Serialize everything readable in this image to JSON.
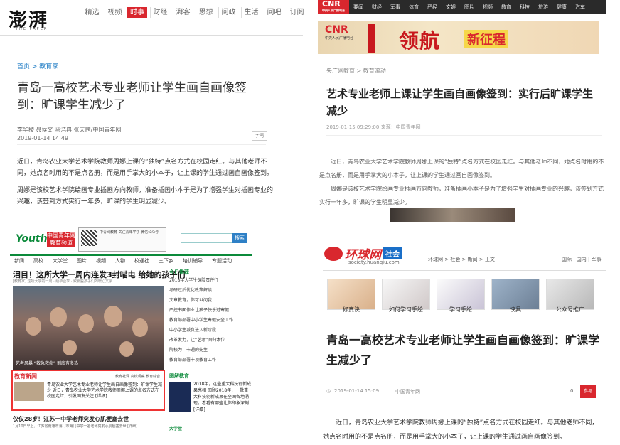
{
  "thepaper": {
    "logo": "澎湃",
    "logo_sub": "THE PAPER",
    "nav": [
      "精选",
      "视频",
      "时事",
      "财经",
      "湃客",
      "思想",
      "问政",
      "生活",
      "问吧",
      "订阅"
    ],
    "active_nav": "时事",
    "breadcrumb": "首页 > 教育家",
    "title": "青岛一高校艺术专业老师让学生画自画像签到：旷课学生减少了",
    "authors": "李华稷 聂侯文 马浩冉 张天茜/中国青年网",
    "date": "2019-01-14 14:49",
    "font_size_label": "字号",
    "para1": "近日，青岛农业大学艺术学院教师周娜上课的“独特”点名方式在校园走红。与其他老师不同，她点名时用的不是点名册，而是用手掌大的小本子，让上课的学生通过画自画像签到。",
    "para2": "周娜是该校艺术学院绘画专业插画方向教师，准备插画小本子是为了增强学生对插画专业的兴趣，该签到方式实行一年多，旷课的学生明显减少。"
  },
  "youth": {
    "logo": "Youth.cn",
    "badge": "中国青年网 教育频道",
    "wx_text": "中青网教育 关注青年学子 微信公众号",
    "search_label": "搜索",
    "nav": [
      "新闻",
      "高校",
      "大学堂",
      "图片",
      "视频",
      "人物",
      "校通社",
      "三下乡",
      "培训辅导",
      "专题活动"
    ],
    "headline": "泪目！这所大学一周内连发3封喵电 给她的孩子们",
    "subline": "[教育家] 这所大学的一周 · 给毕业季 · 致那些孩子们的暖心文字",
    "img_caption": "艺考风暴 “救急救命” 到底有多热",
    "edu_title": "教育新闻",
    "edu_more": "教育社评 高校观察 教育综合",
    "edu_article": "青岛农业大学艺术专业老师让学生画自画像签到：旷课学生减少 近日，青岛农业大学艺术学院教师周娜上课的点名方式在校园走红，引发网友关注 [详细]",
    "bottom_head": "仅仅28岁！江苏一中学老师突发心肌梗塞去世",
    "bottom_sub": "1月10日早上，江苏省南通市海门市海门中学一名老师突发心肌梗塞去世 [详细]",
    "side_title": "今日推荐",
    "side_items": [
      "2018年大学生保险责任行",
      "考研过后优化政策解读",
      "文章教育，你可以问我",
      "严控书面作业让孩子快乐过寒假",
      "教育部部署中小学生寒假安全工作",
      "中小学生减负进入新阶段",
      "改革发力，让“艺考”回归本位",
      "院校为：卡通的先生",
      "教育部部署十项教育工作"
    ],
    "side2_title": "图解教育",
    "book_text": "2018年，这些重大科技创新成果亮相 回顾2018年，一批重大科技创新成果在全国各地涌现，看看有哪些让你印象深刻 [详细]",
    "side3_title": "大学堂"
  },
  "cnr": {
    "logo": "CNR",
    "logo_sub": "中央人民广播电台",
    "nav": [
      "要闻",
      "财经",
      "军事",
      "体育",
      "严经",
      "文娱",
      "图片",
      "视频",
      "教育",
      "科技",
      "旅游",
      "健康",
      "汽车"
    ],
    "banner_logo": "CNR",
    "banner_logo_sub": "中央人民广播电台",
    "banner_text1": "领航",
    "banner_text2": "新征程",
    "breadcrumb": "央广网教育 > 教育滚动",
    "title": "艺术专业老师上课让学生画自画像签到：实行后旷课学生减少",
    "meta": "2019-01-15 09:29:00   来源：中国青年网",
    "para1": "近日，青岛农业大学艺术学院教师周娜上课的“独特”点名方式在校园走红。与其他老师不同，她点名时用的不是点名册，而是用手掌大的小本子，让上课的学生通过画自画像签到。",
    "para2": "周娜是该校艺术学院绘画专业插画方向教师，准备插画小本子是为了增强学生对插画专业的兴趣，该签到方式实行一年多，旷课的学生明显减少。"
  },
  "huanqiu": {
    "logo": "环球网",
    "tag": "社会",
    "url": "society.huanqiu.com",
    "breadcrumb": "环球网 > 社会 > 新闻 > 正文",
    "right_links": "国际 | 国内 | 军事",
    "cards": [
      "修真诀",
      "如何学习手绘",
      "学习手绘",
      "快具",
      "公众号推广"
    ],
    "title": "青岛一高校艺术专业老师让学生画自画像签到：旷课学生减少了",
    "date": "2019-01-14 15:09",
    "source": "中国青年网",
    "comment_count": "0",
    "share_label": "参与",
    "para1": "近日，青岛农业大学艺术学院教师周娜上课的“独特”点名方式在校园走红。与其他老师不同，她点名时用的不是点名册，而是用手掌大的小本子，让上课的学生通过画自画像签到。"
  }
}
